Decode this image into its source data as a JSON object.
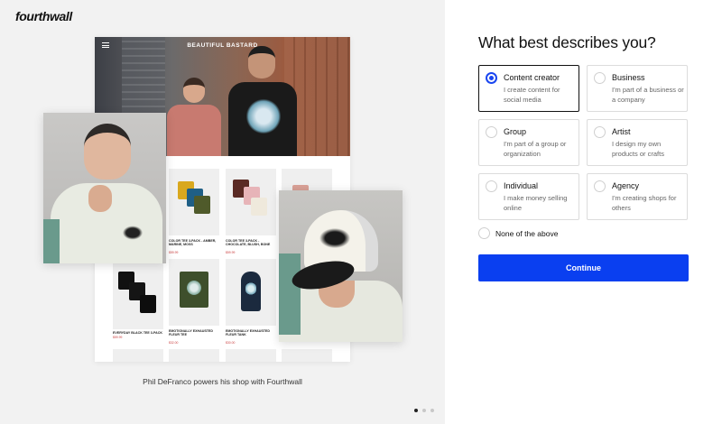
{
  "brand": {
    "logo_text": "fourthwall"
  },
  "showcase": {
    "store_title": "BEAUTIFUL BASTARD",
    "caption": "Phil DeFranco powers his shop with Fourthwall",
    "products": [
      {
        "name": "COLOR TEE 3-PACK - AMBER, MARINE, MOSS",
        "price": "$59.99"
      },
      {
        "name": "COLOR TEE 3-PACK - CHOCOLATE, BLUSH, BONE",
        "price": "$59.99"
      },
      {
        "name": "EVERYDAY BLACK TEE 3-PACK",
        "price": "$59.99"
      },
      {
        "name": "EMOTIONALLY EXHAUSTED FLEUR TEE",
        "price": "$32.00"
      },
      {
        "name": "EMOTIONALLY EXHAUSTED FLEUR TANK",
        "price": "$30.00"
      }
    ],
    "carousel": {
      "total": 3,
      "active": 1
    }
  },
  "form": {
    "heading": "What best describes you?",
    "options": [
      {
        "title": "Content creator",
        "desc": "I create content for social media",
        "selected": true
      },
      {
        "title": "Business",
        "desc": "I'm part of a business or a company",
        "selected": false
      },
      {
        "title": "Group",
        "desc": "I'm part of a group or organization",
        "selected": false
      },
      {
        "title": "Artist",
        "desc": "I design my own products or crafts",
        "selected": false
      },
      {
        "title": "Individual",
        "desc": "I make money selling online",
        "selected": false
      },
      {
        "title": "Agency",
        "desc": "I'm creating shops for others",
        "selected": false
      }
    ],
    "none_label": "None of the above",
    "continue_label": "Continue"
  },
  "colors": {
    "accent": "#0a3ff0",
    "selected_radio": "#1a46f0",
    "left_bg": "#f2f2f2"
  }
}
